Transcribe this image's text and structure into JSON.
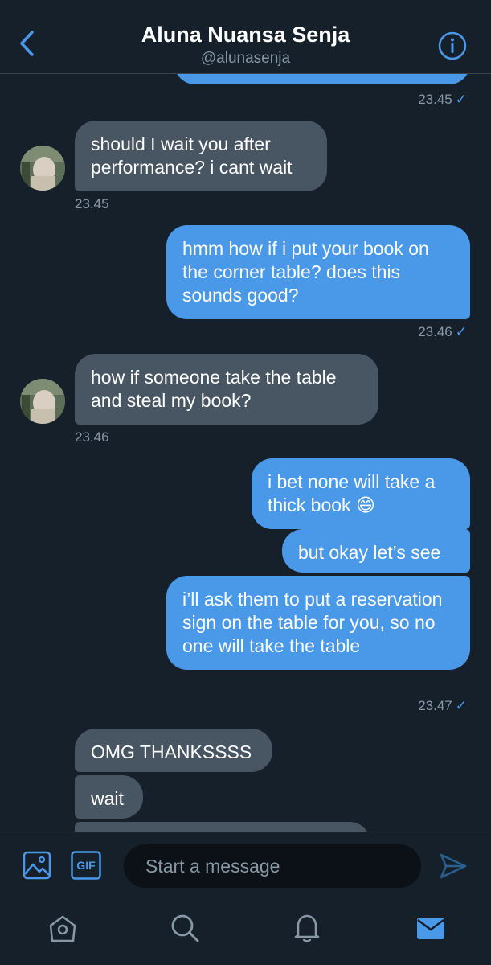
{
  "header": {
    "title": "Aluna Nuansa Senja",
    "handle": "@alunasenja"
  },
  "messages": [
    {
      "type": "sent",
      "text": "",
      "partial": true
    },
    {
      "type": "time",
      "align": "right",
      "text": "23.45",
      "read": true
    },
    {
      "type": "received",
      "text": "should I wait you after performance? i cant wait"
    },
    {
      "type": "time",
      "align": "left",
      "text": "23.45"
    },
    {
      "type": "sent",
      "text": "hmm how if i put your book on the corner table? does this sounds good?"
    },
    {
      "type": "time",
      "align": "right",
      "text": "23.46",
      "read": true
    },
    {
      "type": "received",
      "text": "how if someone take the table and steal my book?"
    },
    {
      "type": "time",
      "align": "left",
      "text": "23.46"
    },
    {
      "type": "sent",
      "text": "i bet none will take a thick book 😄"
    },
    {
      "type": "sent",
      "text": "but okay let’s see"
    },
    {
      "type": "sent",
      "text": "i’ll ask them to put a reservation sign on the table for you, so no one will take the table"
    },
    {
      "type": "time",
      "align": "right",
      "text": "23.47",
      "read": true
    },
    {
      "type": "received",
      "text": "OMG THANKSSSS"
    },
    {
      "type": "received",
      "text": "wait"
    }
  ],
  "composer": {
    "placeholder": "Start a message",
    "gif_label": "GIF"
  },
  "icons": {
    "back": "chevron-left-icon",
    "info": "info-icon",
    "image": "image-icon",
    "gif": "gif-icon",
    "send": "send-icon",
    "home": "home-icon",
    "search": "search-icon",
    "notifications": "bell-icon",
    "messages": "mail-icon"
  },
  "colors": {
    "background": "#15202b",
    "accent": "#4a99e9",
    "received_bubble": "#485563",
    "muted_text": "#8899a6",
    "divider": "#38444d"
  }
}
